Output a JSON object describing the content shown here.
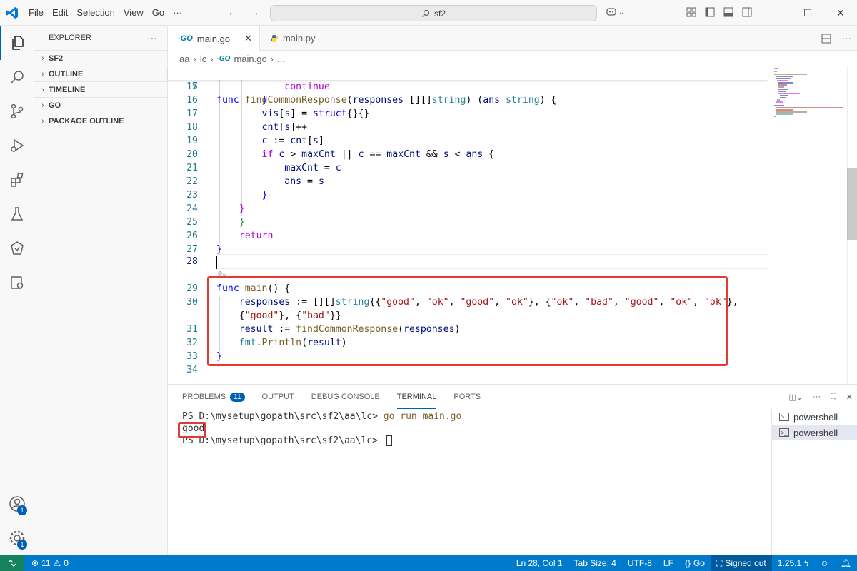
{
  "titlebar": {
    "menu": [
      "File",
      "Edit",
      "Selection",
      "View",
      "Go",
      "···"
    ],
    "search": "sf2"
  },
  "sidebar": {
    "title": "EXPLORER",
    "more": "···",
    "sections": [
      "SF2",
      "OUTLINE",
      "TIMELINE",
      "GO",
      "PACKAGE OUTLINE"
    ]
  },
  "activity_badges": {
    "accounts": "1",
    "manage": "1"
  },
  "tabs": [
    {
      "label": "main.go",
      "active": true,
      "icon": "go-icon"
    },
    {
      "label": "main.py",
      "active": false,
      "icon": "python-icon"
    }
  ],
  "breadcrumb": {
    "parts": [
      "aa",
      "lc",
      "main.go",
      "..."
    ]
  },
  "code": {
    "sticky_line_number": "7",
    "lines": [
      {
        "n": "15"
      },
      {
        "n": "16"
      },
      {
        "n": "17"
      },
      {
        "n": "18"
      },
      {
        "n": "19"
      },
      {
        "n": "20"
      },
      {
        "n": "21"
      },
      {
        "n": "22"
      },
      {
        "n": "23"
      },
      {
        "n": "24"
      },
      {
        "n": "25"
      },
      {
        "n": "26"
      },
      {
        "n": "27"
      },
      {
        "n": "28"
      },
      {
        "n": "29"
      },
      {
        "n": "30"
      },
      {
        "n": ""
      },
      {
        "n": "31"
      },
      {
        "n": "32"
      },
      {
        "n": "33"
      },
      {
        "n": "34"
      }
    ]
  },
  "panel": {
    "tabs": [
      "PROBLEMS",
      "OUTPUT",
      "DEBUG CONSOLE",
      "TERMINAL",
      "PORTS"
    ],
    "problems_count": "11",
    "terminal": {
      "prompt1": "PS D:\\mysetup\\gopath\\src\\sf2\\aa\\lc> ",
      "command": "go run main.go",
      "output": "good",
      "prompt2": "PS D:\\mysetup\\gopath\\src\\sf2\\aa\\lc> "
    },
    "shells": [
      "powershell",
      "powershell"
    ]
  },
  "statusbar": {
    "errors": "11",
    "warnings": "0",
    "position": "Ln 28, Col 1",
    "tabsize": "Tab Size: 4",
    "encoding": "UTF-8",
    "eol": "LF",
    "language": "Go",
    "account": "Signed out",
    "version": "1.25.1"
  },
  "colors": {
    "accent": "#005fb8",
    "statusbar": "#007acc",
    "highlight_box": "#e53935"
  }
}
